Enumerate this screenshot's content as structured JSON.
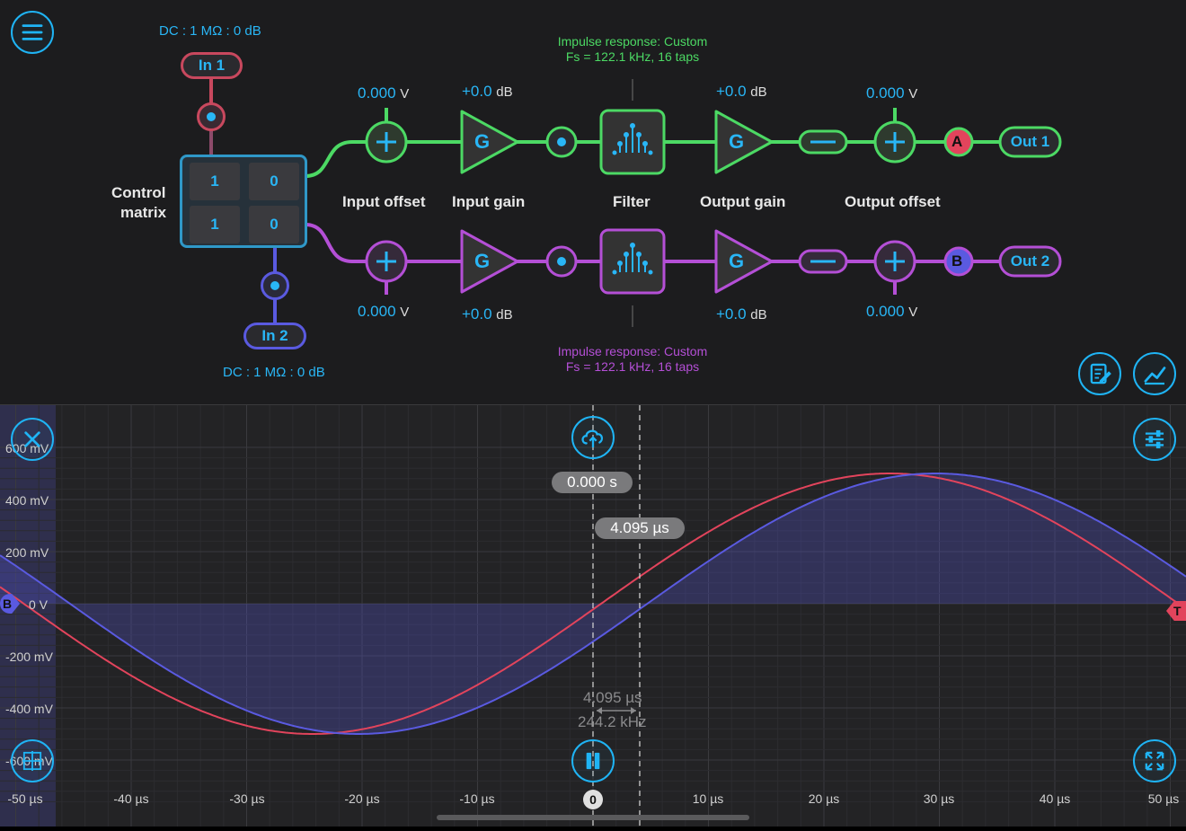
{
  "top": {
    "in1": {
      "label": "In 1",
      "status": "DC : 1 MΩ : 0 dB"
    },
    "in2": {
      "label": "In 2",
      "status": "DC : 1 MΩ : 0 dB"
    },
    "control_matrix": {
      "label_line1": "Control",
      "label_line2": "matrix",
      "cells": [
        "1",
        "0",
        "1",
        "0"
      ]
    },
    "labels": {
      "input_offset": "Input offset",
      "input_gain": "Input gain",
      "filter": "Filter",
      "output_gain": "Output gain",
      "output_offset": "Output offset"
    },
    "ch1": {
      "input_offset_value": "0.000",
      "input_offset_unit": "V",
      "input_gain_value": "+0.0",
      "input_gain_unit": "dB",
      "filter_line1": "Impulse response: Custom",
      "filter_line2": "Fs = 122.1 kHz, 16 taps",
      "output_gain_value": "+0.0",
      "output_gain_unit": "dB",
      "output_offset_value": "0.000",
      "output_offset_unit": "V",
      "probe": "A",
      "out_label": "Out 1",
      "color": "#4cd964"
    },
    "ch2": {
      "input_offset_value": "0.000",
      "input_offset_unit": "V",
      "input_gain_value": "+0.0",
      "input_gain_unit": "dB",
      "filter_line1": "Impulse response: Custom",
      "filter_line2": "Fs = 122.1 kHz, 16 taps",
      "output_gain_value": "+0.0",
      "output_gain_unit": "dB",
      "output_offset_value": "0.000",
      "output_offset_unit": "V",
      "probe": "B",
      "out_label": "Out 2",
      "color": "#b44fd6"
    },
    "gain_glyph": "G"
  },
  "scope": {
    "y_labels": [
      "600 mV",
      "400 mV",
      "200 mV",
      "0 V",
      "-200 mV",
      "-400 mV",
      "-600 mV"
    ],
    "x_labels": [
      "-50 µs",
      "-40 µs",
      "-30 µs",
      "-20 µs",
      "-10 µs",
      "0",
      "10 µs",
      "20 µs",
      "30 µs",
      "40 µs",
      "50 µs"
    ],
    "time_cursor": "0.000 s",
    "delta_cursor": "4.095 µs",
    "measure_period": "4.095 µs",
    "measure_freq": "244.2 kHz",
    "channel_marker": "B",
    "trigger_marker": "T",
    "trigger_time_marker": "0",
    "colors": {
      "probe_a": "#e2445c",
      "probe_b": "#5a5ae0",
      "accent": "#1fb4f5"
    }
  }
}
